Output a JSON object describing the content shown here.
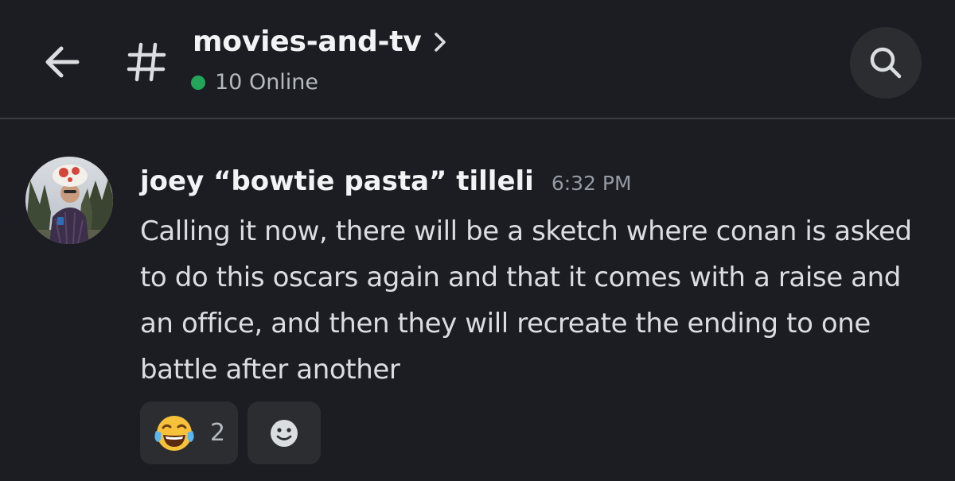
{
  "header": {
    "channel_name": "movies-and-tv",
    "online_status": "10 Online",
    "icons": {
      "back": "arrow-left-icon",
      "channel": "hash-icon",
      "chevron": "chevron-right-icon",
      "search": "search-icon"
    }
  },
  "message": {
    "username": "joey “bowtie pasta” tilleli",
    "timestamp": "6:32 PM",
    "body": "Calling it now, there will be a sketch where conan is asked to do this oscars again and that it comes with a raise and an office, and then they will recreate the ending to one battle after another",
    "reactions": [
      {
        "emoji_icon": "face-with-tears-of-joy-icon",
        "count": "2"
      },
      {
        "emoji_icon": "add-reaction-smiley-icon"
      }
    ]
  },
  "colors": {
    "background": "#1c1d22",
    "surface": "#2b2d31",
    "online_green": "#23a55a",
    "text_primary": "#f2f3f5",
    "text_muted": "#949ba4"
  }
}
